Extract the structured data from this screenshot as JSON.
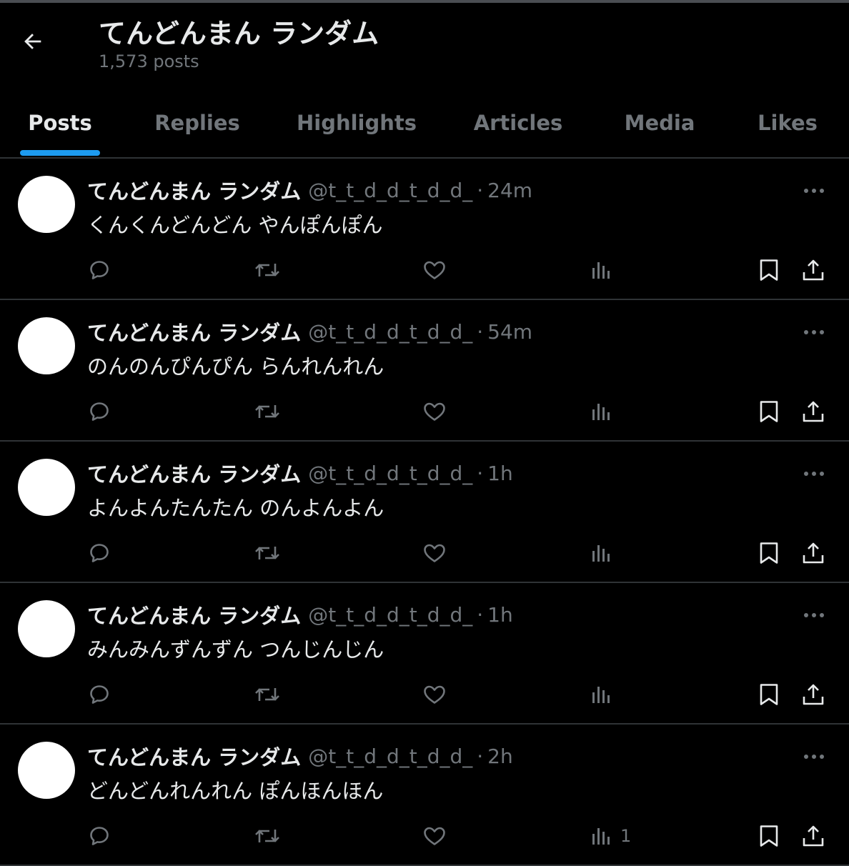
{
  "header": {
    "profile_name": "てんどんまん ランダム",
    "post_count": "1,573 posts"
  },
  "tabs": [
    {
      "label": "Posts",
      "active": true
    },
    {
      "label": "Replies",
      "active": false
    },
    {
      "label": "Highlights",
      "active": false
    },
    {
      "label": "Articles",
      "active": false
    },
    {
      "label": "Media",
      "active": false
    },
    {
      "label": "Likes",
      "active": false
    }
  ],
  "posts": [
    {
      "name": "てんどんまん ランダム",
      "handle": "@t_t_d_d_t_d_d_",
      "separator": "·",
      "time": "24m",
      "text": "くんくんどんどん やんぽんぽん",
      "views": ""
    },
    {
      "name": "てんどんまん ランダム",
      "handle": "@t_t_d_d_t_d_d_",
      "separator": "·",
      "time": "54m",
      "text": "のんのんぴんぴん らんれんれん",
      "views": ""
    },
    {
      "name": "てんどんまん ランダム",
      "handle": "@t_t_d_d_t_d_d_",
      "separator": "·",
      "time": "1h",
      "text": "よんよんたんたん のんよんよん",
      "views": ""
    },
    {
      "name": "てんどんまん ランダム",
      "handle": "@t_t_d_d_t_d_d_",
      "separator": "·",
      "time": "1h",
      "text": "みんみんずんずん つんじんじん",
      "views": ""
    },
    {
      "name": "てんどんまん ランダム",
      "handle": "@t_t_d_d_t_d_d_",
      "separator": "·",
      "time": "2h",
      "text": "どんどんれんれん ぽんほんほん",
      "views": "1"
    }
  ],
  "icons": {
    "back": "arrow-left-icon",
    "more": "more-horizontal-icon",
    "reply": "reply-icon",
    "repost": "repost-icon",
    "like": "heart-icon",
    "views": "views-icon",
    "bookmark": "bookmark-icon",
    "share": "share-icon"
  },
  "colors": {
    "background": "#000000",
    "text_primary": "#e7e9ea",
    "text_secondary": "#71767b",
    "accent": "#1d9bf0",
    "divider": "#2f3336"
  }
}
